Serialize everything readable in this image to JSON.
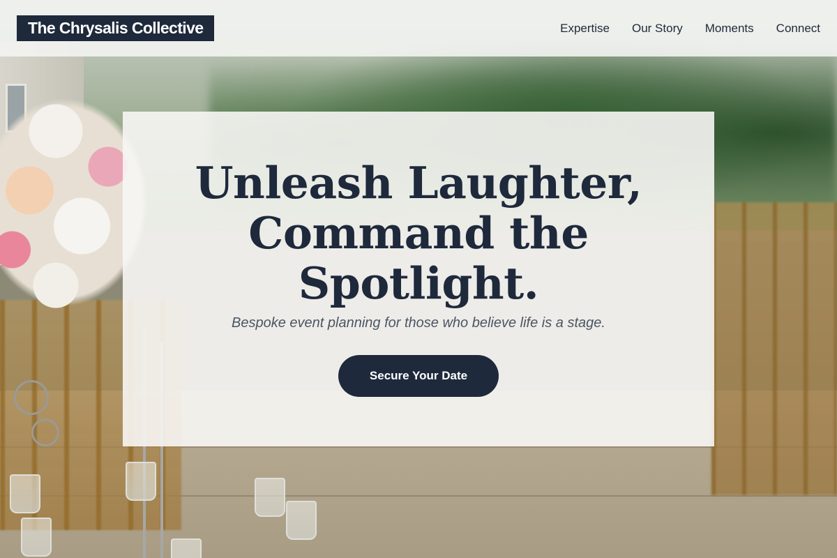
{
  "header": {
    "logo_text": "The Chrysalis Collective",
    "nav": [
      {
        "label": "Expertise"
      },
      {
        "label": "Our Story"
      },
      {
        "label": "Moments"
      },
      {
        "label": "Connect"
      }
    ]
  },
  "hero": {
    "headline_lines": [
      "Unleash Laughter,",
      "Command the",
      "Spotlight."
    ],
    "subheading": "Bespoke event planning for those who believe life is a stage.",
    "cta_label": "Secure Your Date"
  },
  "colors": {
    "brand_navy": "#1e293b",
    "subtext_gray": "#4b5563",
    "card_background": "#f7f6f4"
  }
}
